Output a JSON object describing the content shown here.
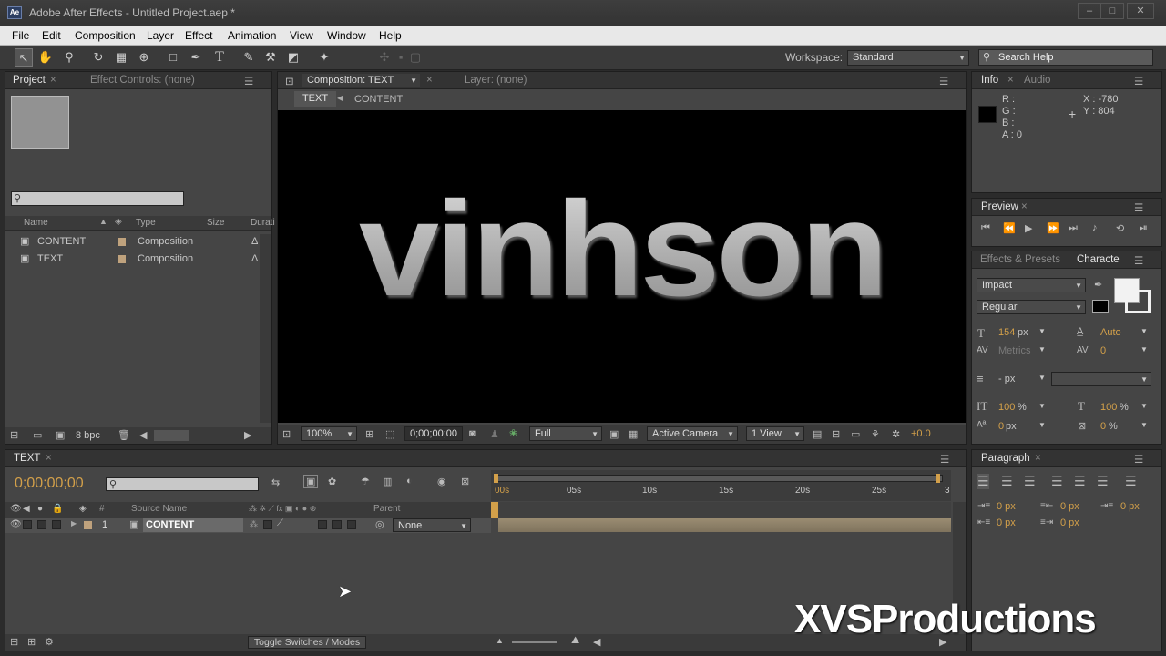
{
  "window": {
    "title": "Adobe After Effects - Untitled Project.aep *",
    "app_icon": "Ae"
  },
  "menu": [
    "File",
    "Edit",
    "Composition",
    "Layer",
    "Effect",
    "Animation",
    "View",
    "Window",
    "Help"
  ],
  "workspace": {
    "label": "Workspace:",
    "value": "Standard"
  },
  "search_help": "Search Help",
  "project": {
    "tab": "Project",
    "effect_tab": "Effect Controls: (none)",
    "cols": [
      "Name",
      "Type",
      "Size",
      "Durati"
    ],
    "items": [
      {
        "name": "CONTENT",
        "type": "Composition",
        "dur": "Δ"
      },
      {
        "name": "TEXT",
        "type": "Composition",
        "dur": "Δ"
      }
    ],
    "bpc": "8 bpc"
  },
  "comp": {
    "tab": "Composition: TEXT",
    "layer_tab": "Layer: (none)",
    "crumb1": "TEXT",
    "crumb2": "CONTENT",
    "text": "vinhson",
    "zoom": "100%",
    "timecode": "0;00;00;00",
    "resolution": "Full",
    "camera": "Active Camera",
    "views": "1 View",
    "exposure": "+0.0"
  },
  "info": {
    "tab": "Info",
    "audio_tab": "Audio",
    "r": "R :",
    "g": "G :",
    "b": "B :",
    "a": "A : 0",
    "x": "X : -780",
    "y": "Y : 804"
  },
  "preview": {
    "tab": "Preview"
  },
  "character": {
    "effects_tab": "Effects & Presets",
    "tab": "Characte",
    "font": "Impact",
    "style": "Regular",
    "size": "154",
    "size_unit": "px",
    "leading": "Auto",
    "kerning": "Metrics",
    "tracking": "0",
    "stroke": "- px",
    "vscale": "100",
    "vscale_unit": "%",
    "hscale": "100",
    "hscale_unit": "%",
    "baseline": "0",
    "baseline_unit": "px",
    "tsume": "0",
    "tsume_unit": "%"
  },
  "paragraph": {
    "tab": "Paragraph",
    "v1": "0 px",
    "v2": "0 px",
    "v3": "0 px",
    "v4": "0 px",
    "v5": "0 px"
  },
  "timeline": {
    "tab": "TEXT",
    "timecode": "0;00;00;00",
    "col_source": "Source Name",
    "col_parent": "Parent",
    "layer_num": "1",
    "layer_name": "CONTENT",
    "parent": "None",
    "ticks": [
      "00s",
      "05s",
      "10s",
      "15s",
      "20s",
      "25s",
      "3"
    ],
    "toggle": "Toggle Switches / Modes"
  },
  "watermark": "XVSProductions"
}
